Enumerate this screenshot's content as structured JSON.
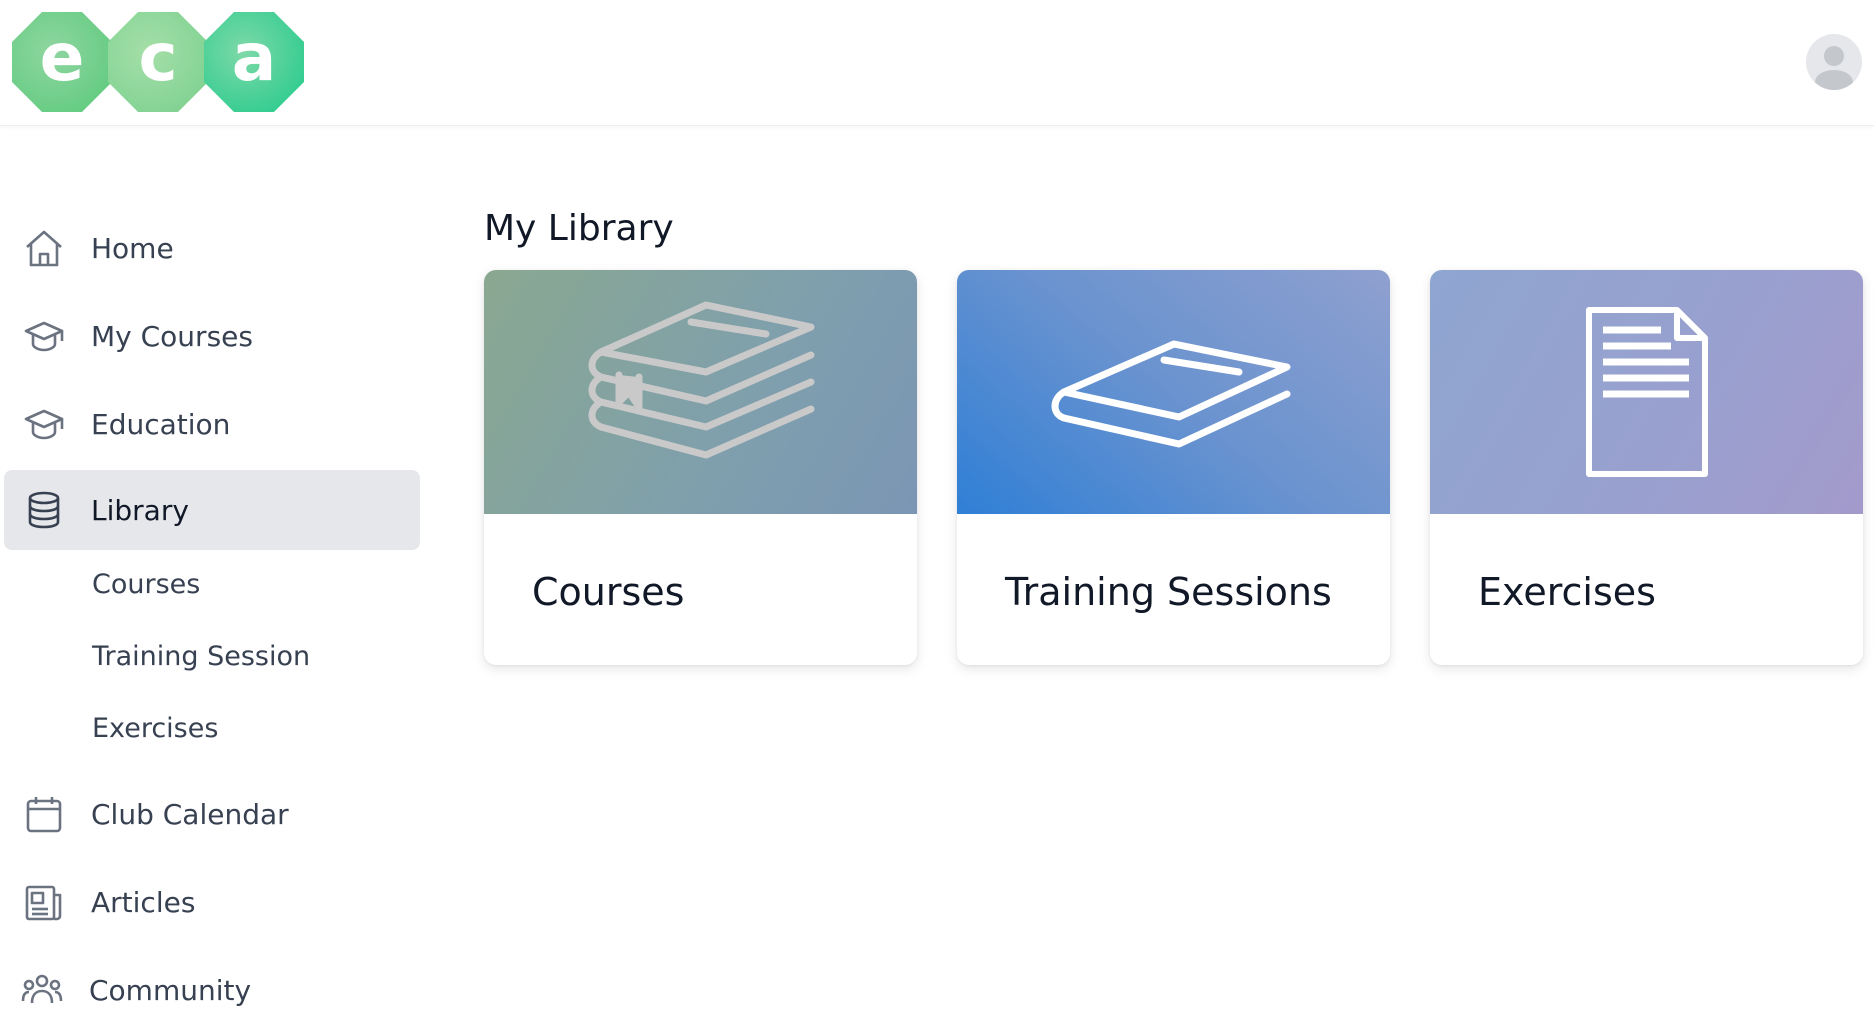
{
  "logo": {
    "letters": [
      "e",
      "c",
      "a"
    ]
  },
  "header": {
    "avatar_icon": "user-avatar-icon"
  },
  "sidebar": {
    "items": [
      {
        "label": "Home",
        "icon": "home-icon"
      },
      {
        "label": "My Courses",
        "icon": "graduation-cap-icon"
      },
      {
        "label": "Education",
        "icon": "graduation-cap-icon"
      },
      {
        "label": "Library",
        "icon": "database-icon",
        "active": true
      },
      {
        "label": "Club Calendar",
        "icon": "calendar-icon"
      },
      {
        "label": "Articles",
        "icon": "newspaper-icon"
      },
      {
        "label": "Community",
        "icon": "users-icon"
      }
    ],
    "library_subitems": [
      "Courses",
      "Training Session",
      "Exercises"
    ]
  },
  "main": {
    "title": "My Library",
    "cards": [
      {
        "title": "Courses",
        "icon": "books-stack-icon"
      },
      {
        "title": "Training Sessions",
        "icon": "book-icon"
      },
      {
        "title": "Exercises",
        "icon": "document-icon"
      }
    ]
  },
  "colors": {
    "active_nav_bg": "#e5e7eb",
    "text_primary": "#111827",
    "text_secondary": "#374151",
    "icon_gray": "#6b7280",
    "logo_green": "#59c97a"
  }
}
